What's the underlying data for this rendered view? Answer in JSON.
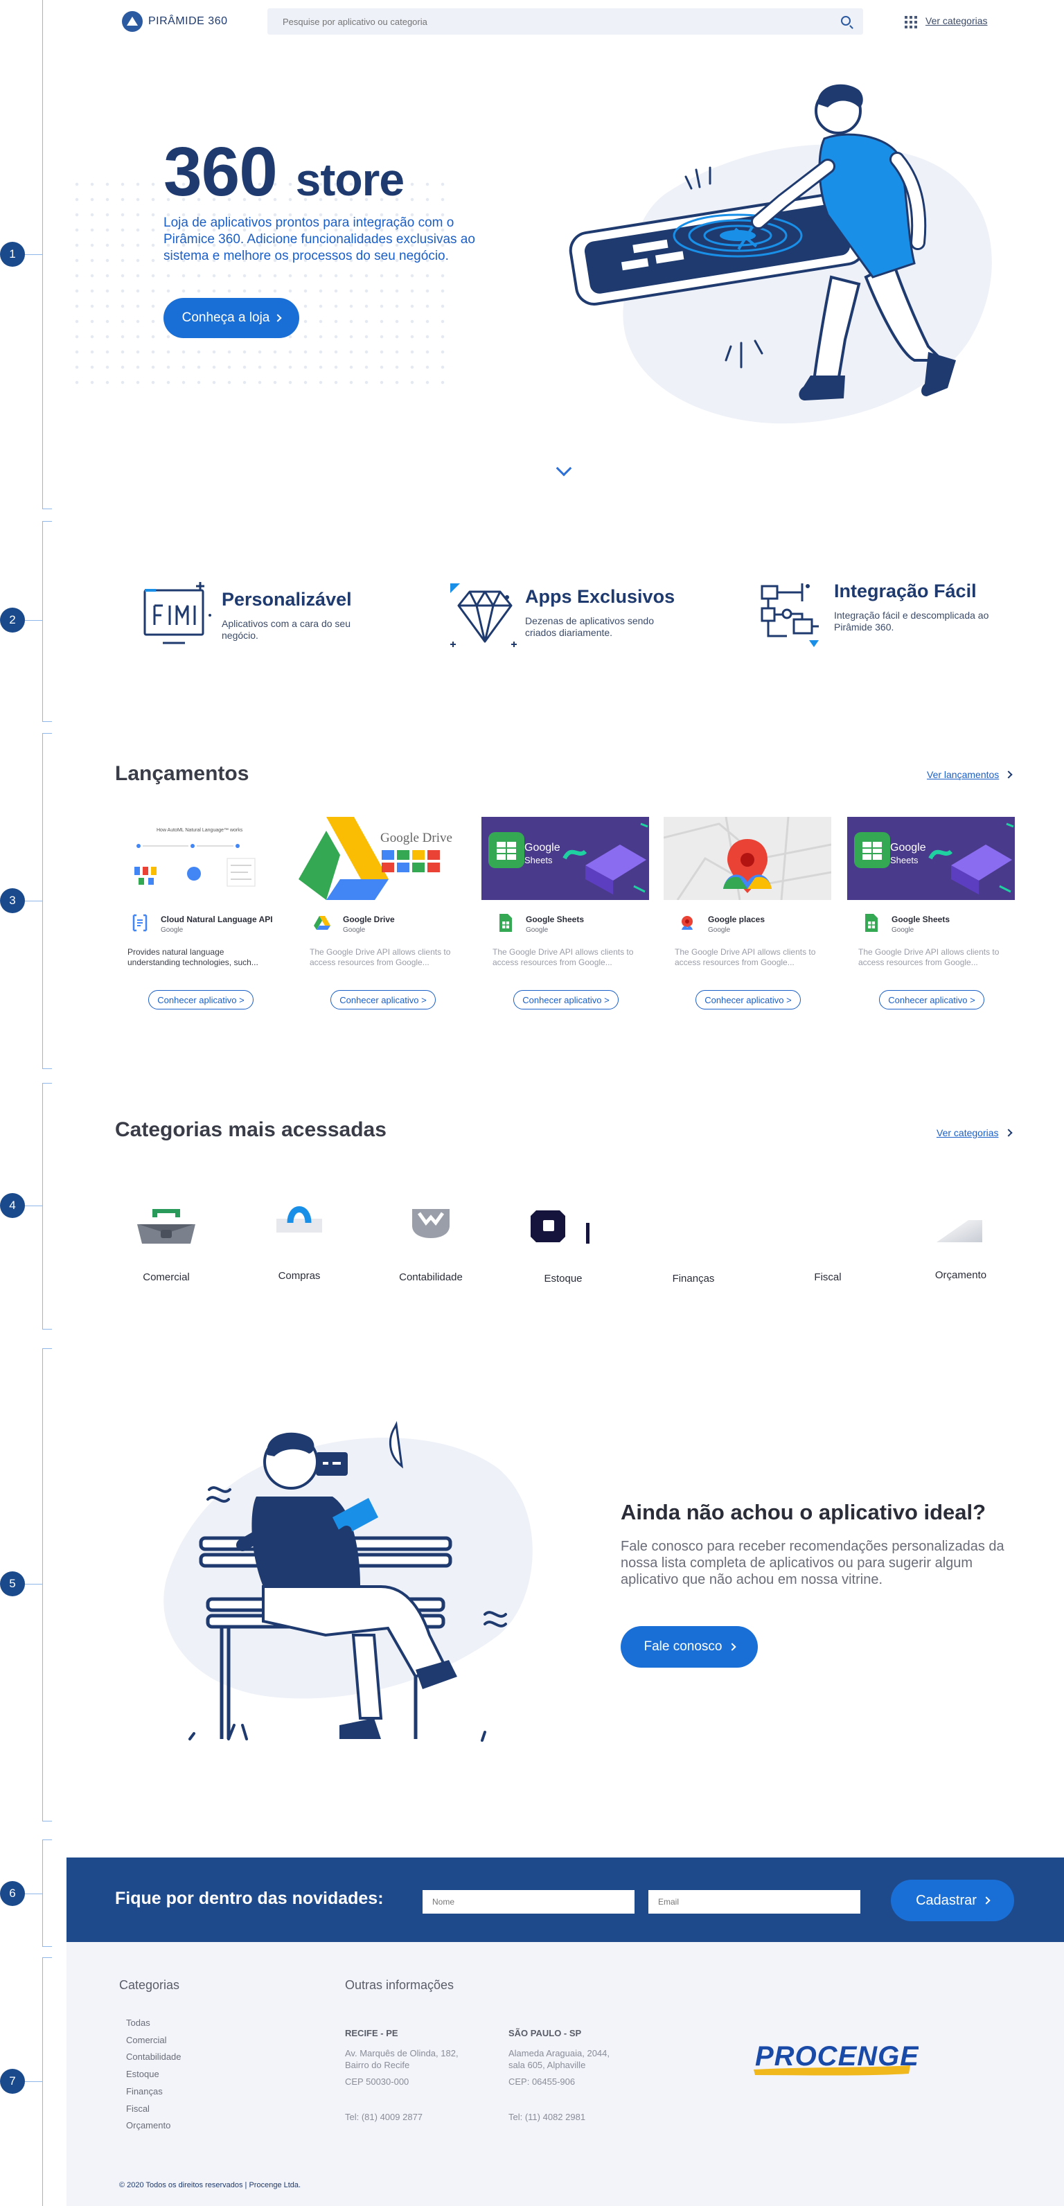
{
  "header": {
    "logo_text": "PIRÂMIDE 360",
    "search_placeholder": "Pesquise por aplicativo ou categoria",
    "categories_link": "Ver categorias"
  },
  "hero": {
    "title_big": "360",
    "title_small": "store",
    "subtitle": "Loja de aplicativos prontos para integração com o Pirâmice 360. Adicione funcionalidades exclusivas ao sistema e melhore os processos do seu negócio.",
    "button": "Conheça a loja"
  },
  "features": [
    {
      "title": "Personalizável",
      "desc": "Aplicativos com a cara do seu negócio.",
      "icon": "customize-icon"
    },
    {
      "title": "Apps Exclusivos",
      "desc": "Dezenas de aplicativos sendo criados diariamente.",
      "icon": "diamond-icon"
    },
    {
      "title": "Integração Fácil",
      "desc": "Integração fácil e descomplicada ao Pirâmide 360.",
      "icon": "integration-icon"
    }
  ],
  "launches": {
    "title": "Lançamentos",
    "link": "Ver lançamentos",
    "header_text": "How AutoML Natural Language™ works",
    "cards": [
      {
        "name": "Cloud Natural Language API",
        "vendor": "Google",
        "desc": "Provides natural language understanding technologies, such...",
        "button": "Conhecer aplicativo >"
      },
      {
        "name": "Google Drive",
        "vendor": "Google",
        "desc": "The Google Drive API allows clients to access resources from Google...",
        "button": "Conhecer aplicativo >",
        "brand": "Google Drive"
      },
      {
        "name": "Google Sheets",
        "vendor": "Google",
        "desc": "The Google Drive API allows clients to access resources from Google...",
        "button": "Conhecer aplicativo >",
        "brand_1": "Google",
        "brand_2": "Sheets"
      },
      {
        "name": "Google places",
        "vendor": "Google",
        "desc": "The Google Drive API allows clients to access resources from Google...",
        "button": "Conhecer aplicativo >"
      },
      {
        "name": "Google Sheets",
        "vendor": "Google",
        "desc": "The Google Drive API allows clients to access resources from Google...",
        "button": "Conhecer aplicativo >",
        "brand_1": "Google",
        "brand_2": "Sheets"
      }
    ]
  },
  "categories": {
    "title": "Categorias mais acessadas",
    "link": "Ver categorias",
    "items": [
      "Comercial",
      "Compras",
      "Contabilidade",
      "Estoque",
      "Finanças",
      "Fiscal",
      "Orçamento"
    ]
  },
  "cta": {
    "title": "Ainda não achou o aplicativo ideal?",
    "text": "Fale conosco para receber recomendações personalizadas da nossa lista completa de aplicativos ou para sugerir algum aplicativo que não achou em nossa vitrine.",
    "button": "Fale conosco"
  },
  "newsletter": {
    "title": "Fique por dentro das novidades:",
    "name_placeholder": "Nome",
    "email_placeholder": "Email",
    "button": "Cadastrar"
  },
  "footer": {
    "categories_title": "Categorias",
    "categories": [
      "Todas",
      "Comercial",
      "Contabilidade",
      "Estoque",
      "Finanças",
      "Fiscal",
      "Orçamento"
    ],
    "info_title": "Outras informações",
    "offices": [
      {
        "city": "RECIFE - PE",
        "address_1": "Av. Marquês de Olinda, 182,",
        "address_2": "Bairro do Recife",
        "cep": "CEP 50030-000",
        "tel": "Tel: (81) 4009 2877"
      },
      {
        "city": "SÃO PAULO - SP",
        "address_1": "Alameda Araguaia, 2044,",
        "address_2": "sala 605, Alphaville",
        "cep": "CEP: 06455-906",
        "tel": "Tel: (11) 4082 2981"
      }
    ],
    "brand": "PROCENGE",
    "copyright": "© 2020 Todos os direitos reservados | Procenge Ltda."
  },
  "rail": {
    "markers": [
      "1",
      "2",
      "3",
      "4",
      "5",
      "6",
      "7"
    ]
  },
  "colors": {
    "primary": "#1a6fd6",
    "navy": "#1e3a6e",
    "newsletter_bg": "#1e4a8c",
    "footer_bg": "#f2f4f9"
  }
}
